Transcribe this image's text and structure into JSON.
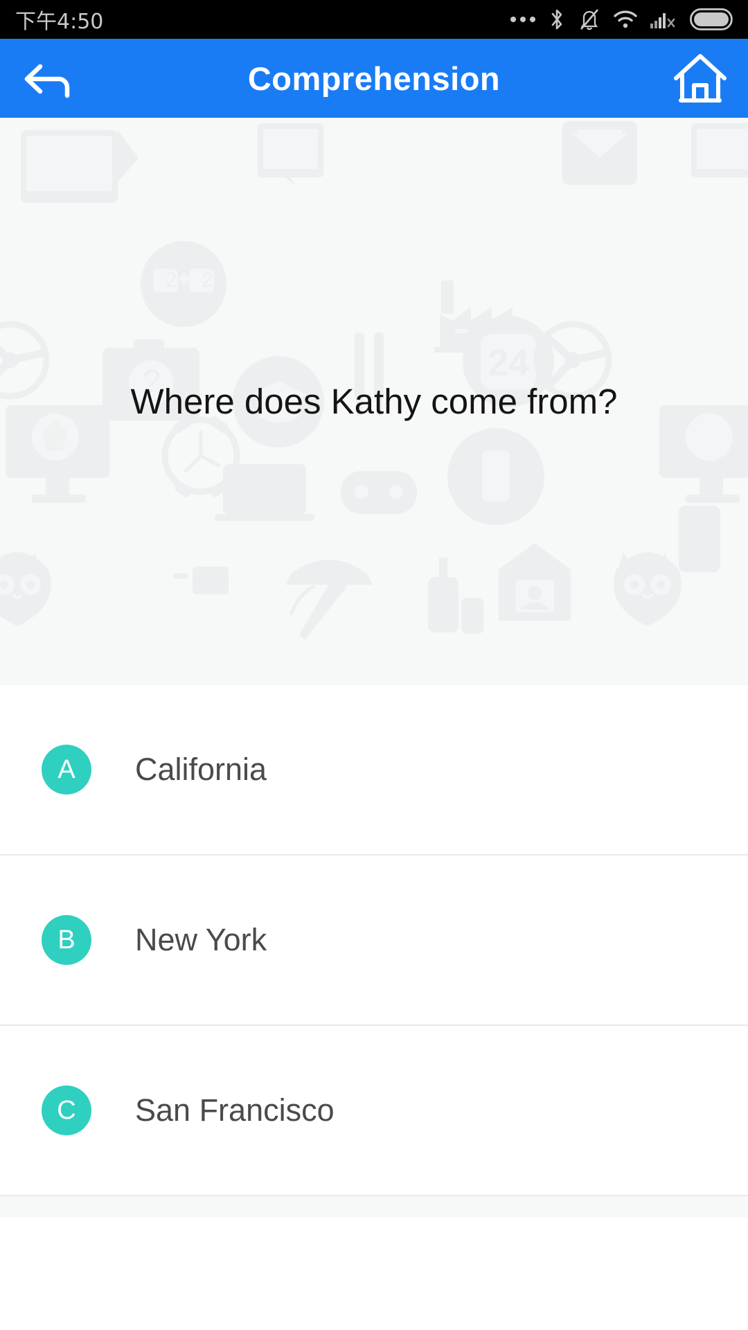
{
  "statusbar": {
    "time": "下午4:50",
    "icons": [
      {
        "name": "more-dots-icon",
        "glyph": "dots"
      },
      {
        "name": "bluetooth-icon",
        "glyph": "bluetooth"
      },
      {
        "name": "ringer-muted-icon",
        "glyph": "bell-slash"
      },
      {
        "name": "wifi-icon",
        "glyph": "wifi"
      },
      {
        "name": "cellular-signal-no-service-icon",
        "glyph": "signal-x"
      },
      {
        "name": "battery-icon",
        "glyph": "battery"
      }
    ]
  },
  "header": {
    "title": "Comprehension",
    "back_label": "Back",
    "home_label": "Home",
    "background_color": "#1a7cf5",
    "text_color": "#ffffff"
  },
  "question": {
    "text": "Where does Kathy come from?",
    "background_color": "#f7f8f8",
    "text_color": "#141414"
  },
  "options": {
    "badge_color": "#2fd0c0",
    "label_color": "#4a4a4a",
    "items": [
      {
        "key": "A",
        "label": "California"
      },
      {
        "key": "B",
        "label": "New York"
      },
      {
        "key": "C",
        "label": "San Francisco"
      }
    ]
  },
  "watermark": {
    "icons": [
      "monitor-icon",
      "math-2plus2-icon",
      "pinwheel-clock-icon",
      "factory-icon",
      "envelope-icon",
      "calendar-24-icon",
      "briefcase-question-icon",
      "graduation-cap-icon",
      "fork-knife-icon",
      "desktop-ball-icon",
      "alarm-clock-icon",
      "owl-icon",
      "baseball-bat-icon",
      "house-photo-icon",
      "gamepad-icon",
      "phone-icon",
      "book-icon"
    ]
  }
}
